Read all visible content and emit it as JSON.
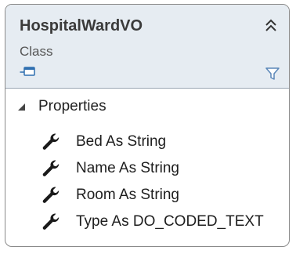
{
  "class_shape": {
    "name": "HospitalWardVO",
    "stereotype": "Class",
    "collapse_icon": "double-chevron-up-icon",
    "type_icon": "class-shortcut-icon",
    "filter_icon": "filter-funnel-icon",
    "colors": {
      "header_background": "#e6ecf2",
      "border": "#8a8a8a",
      "filter_icon": "#5a86b8",
      "type_icon": "#2f6fb0"
    }
  },
  "sections": [
    {
      "label": "Properties",
      "expander_icon": "expanded-triangle-icon",
      "members": [
        {
          "label": "Bed As String",
          "icon": "wrench-property-icon"
        },
        {
          "label": "Name As String",
          "icon": "wrench-property-icon"
        },
        {
          "label": "Room As String",
          "icon": "wrench-property-icon"
        },
        {
          "label": "Type As DO_CODED_TEXT",
          "icon": "wrench-property-icon"
        }
      ]
    }
  ]
}
